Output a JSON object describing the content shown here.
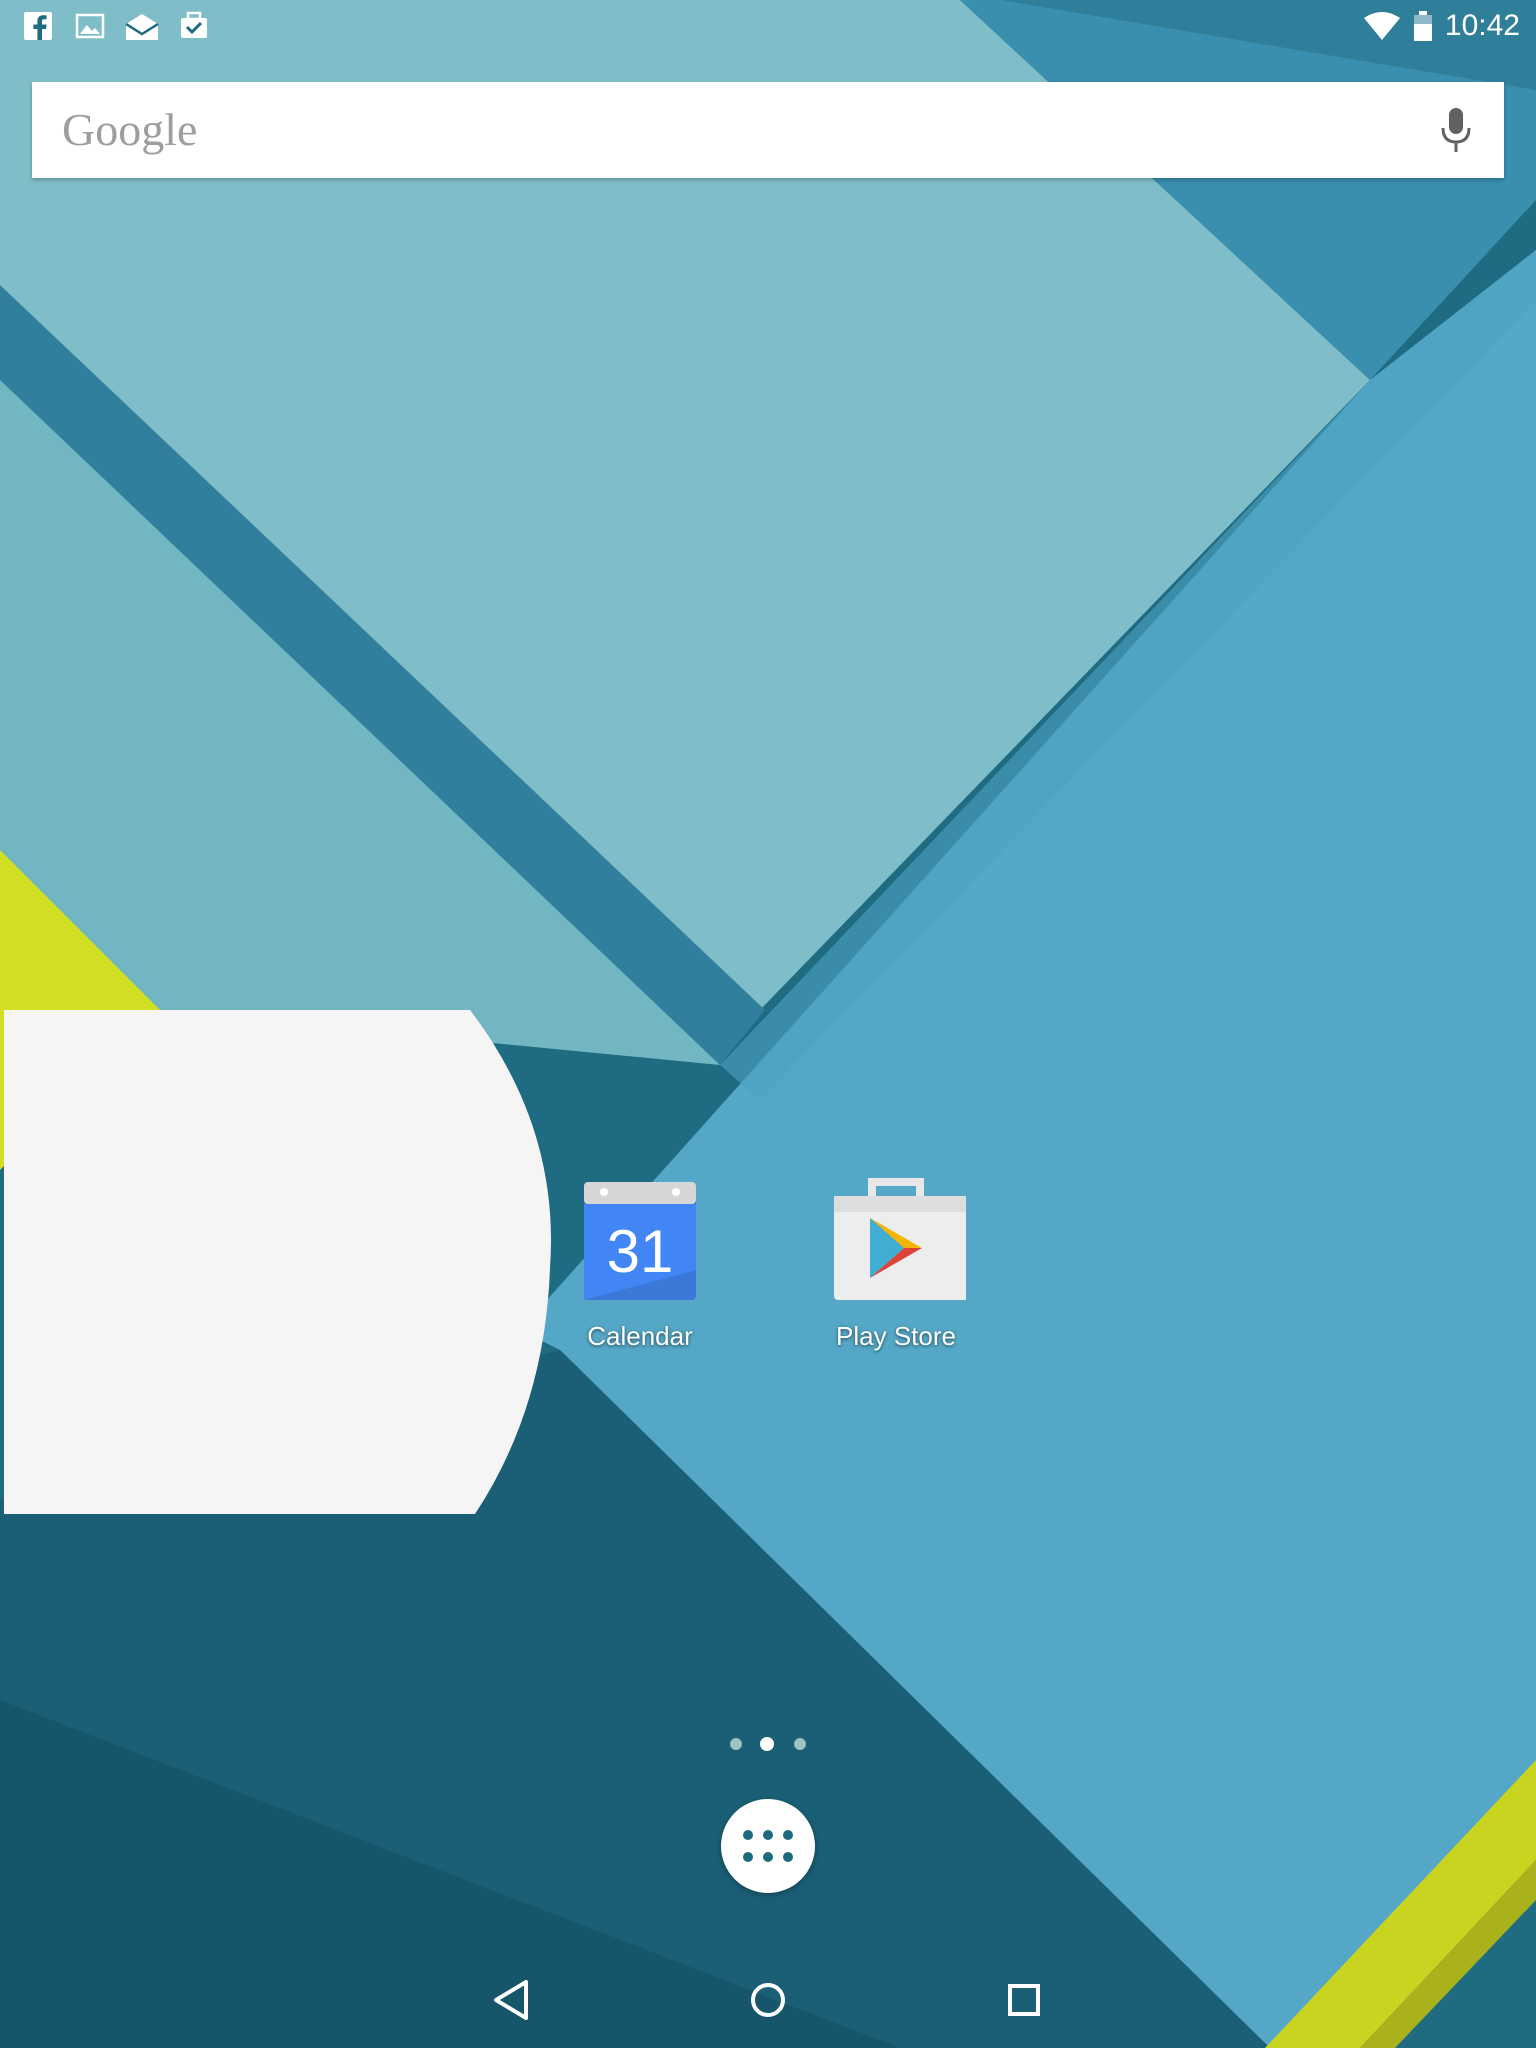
{
  "status_bar": {
    "clock": "10:42",
    "notification_icons": [
      "facebook-icon",
      "gallery-icon",
      "email-icon",
      "task-icon"
    ],
    "system_icons": [
      "wifi-icon",
      "battery-icon"
    ]
  },
  "search_bar": {
    "logo": "Google",
    "mic_icon": "mic-icon"
  },
  "apps": [
    {
      "label": "Calendar",
      "icon": "calendar-icon",
      "date": "31"
    },
    {
      "label": "Play Store",
      "icon": "play-store-icon"
    }
  ],
  "page_indicator": {
    "count": 3,
    "active_index": 1
  },
  "navigation": [
    "back-icon",
    "home-icon",
    "recents-icon"
  ],
  "colors": {
    "wallpaper_dark": "#1d6a80",
    "wallpaper_light": "#7fbfc9",
    "wallpaper_blue": "#55a8c8",
    "accent_yellow": "#d4e020",
    "widget_bg": "#f5f5f5",
    "calendar_blue": "#4285f4"
  }
}
